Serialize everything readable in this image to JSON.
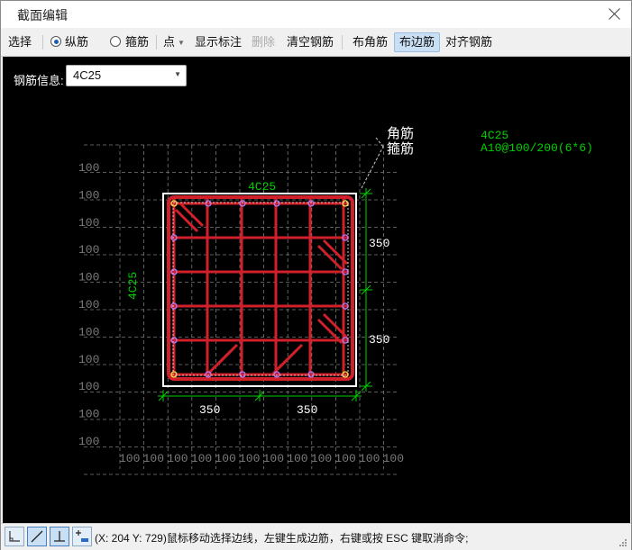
{
  "window": {
    "title": "截面编辑"
  },
  "toolbar": {
    "select": "选择",
    "longitudinal": "纵筋",
    "stirrup": "箍筋",
    "point": "点",
    "show_annotation": "显示标注",
    "delete": "删除",
    "clear_rebar": "清空钢筋",
    "corner_rebar": "布角筋",
    "side_rebar": "布边筋",
    "align_rebar": "对齐钢筋"
  },
  "rebar_info": {
    "label": "钢筋信息:",
    "value": "4C25"
  },
  "drawing": {
    "legend": {
      "corner": "角筋",
      "stirrup": "箍筋"
    },
    "corner_spec": "4C25",
    "stirrup_spec": "A10@100/200(6*6)",
    "top_label": "4C25",
    "left_label": "4C25",
    "dim_h": [
      "350",
      "350"
    ],
    "dim_v": [
      "350",
      "350"
    ],
    "grid_label": "100",
    "colors": {
      "rebar": "#d0202a",
      "dim": "#00d000",
      "grid": "#7a7a7a",
      "text": "#ffffff"
    }
  },
  "status": {
    "text": "(X: 204 Y: 729)鼠标移动选择边线，左键生成边筋，右键或按 ESC 键取消命令;"
  },
  "status_buttons": [
    "orthogonal-icon",
    "line-icon",
    "perpendicular-icon",
    "add-icon"
  ]
}
